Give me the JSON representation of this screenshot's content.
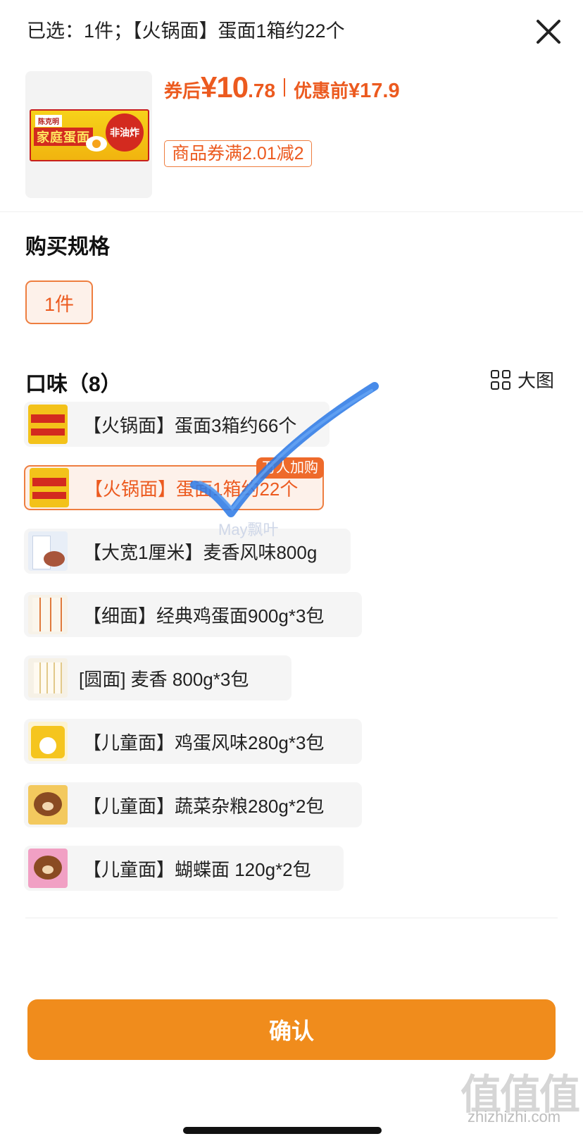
{
  "header": {
    "selected_text": "已选：1件；【火锅面】蛋面1箱约22个",
    "close_icon": "close-icon"
  },
  "product": {
    "image_icon": "product-image",
    "package": {
      "brand": "陈克明",
      "name": "家庭蛋面",
      "badge": "非油炸"
    },
    "price_label": "券后",
    "price_integer": "¥10",
    "price_decimal": ".78",
    "original_label": "优惠前",
    "original_price": "¥17.9",
    "coupon": "商品券满2.01减2"
  },
  "spec": {
    "title": "购买规格",
    "options": [
      "1件"
    ]
  },
  "flavor": {
    "title": "口味（8）",
    "big_view_label": "大图",
    "big_view_icon": "grid-icon",
    "hot_badge": "万人加购",
    "options": [
      {
        "label": "【火锅面】蛋面3箱约66个"
      },
      {
        "label": "【火锅面】蛋面1箱约22个"
      },
      {
        "label": "【大宽1厘米】麦香风味800g"
      },
      {
        "label": "【细面】经典鸡蛋面900g*3包"
      },
      {
        "label": "[圆面] 麦香 800g*3包"
      },
      {
        "label": "【儿童面】鸡蛋风味280g*3包"
      },
      {
        "label": "【儿童面】蔬菜杂粮280g*2包"
      },
      {
        "label": "【儿童面】蝴蝶面 120g*2包"
      }
    ]
  },
  "annotation": {
    "watermark": "May飘叶"
  },
  "footer": {
    "confirm": "确认"
  },
  "site_watermark": {
    "logo": "值值值",
    "url": "zhizhizhi.com"
  },
  "colors": {
    "accent": "#ec5a1f",
    "confirm_bg": "#f08c1c",
    "check_mark": "#2f7be6"
  }
}
